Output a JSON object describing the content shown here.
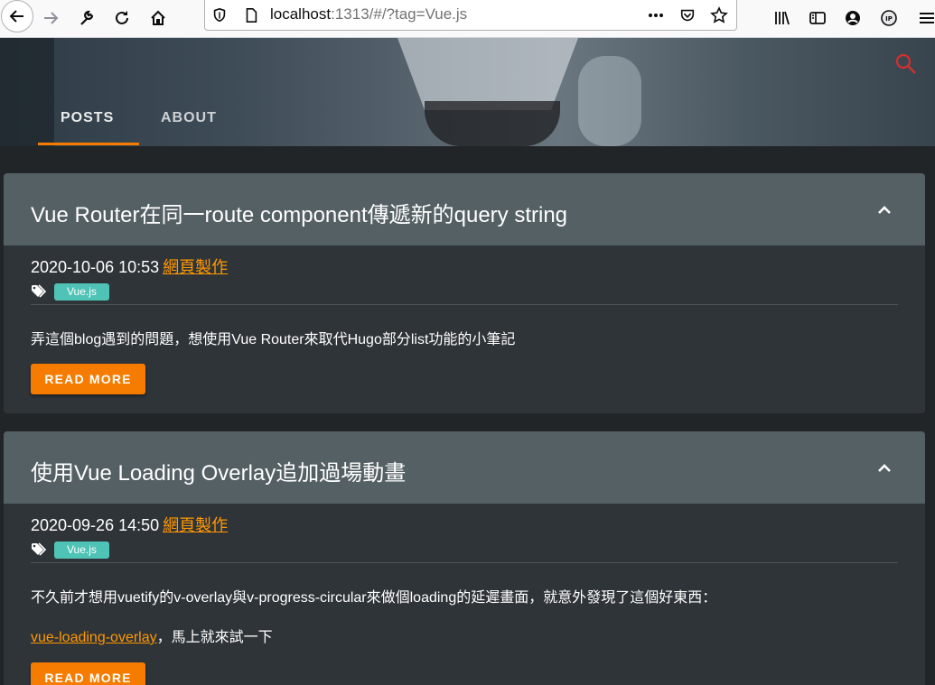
{
  "browser": {
    "url_host": "localhost",
    "url_rest": ":1313/#/?tag=Vue.js",
    "icons": [
      "back-icon",
      "forward-icon",
      "wrench-icon",
      "reload-icon",
      "home-icon",
      "shield-icon",
      "page-icon",
      "more-icon",
      "pocket-icon",
      "bookmark-star-icon",
      "library-icon",
      "sidebar-icon",
      "account-icon",
      "ip-extension-icon",
      "menu-icon"
    ]
  },
  "nav": {
    "posts": "POSTS",
    "about": "ABOUT",
    "active": "POSTS",
    "accent": "#f57c00"
  },
  "posts": [
    {
      "title": "Vue Router在同一route component傳遞新的query string",
      "date": "2020-10-06 10:53",
      "category": "網頁製作",
      "tag": "Vue.js",
      "summary": "弄這個blog遇到的問題，想使用Vue Router來取代Hugo部分list功能的小筆記",
      "read_more": "READ MORE"
    },
    {
      "title": "使用Vue Loading Overlay追加過場動畫",
      "date": "2020-09-26 14:50",
      "category": "網頁製作",
      "tag": "Vue.js",
      "summary": "不久前才想用vuetify的v-overlay與v-progress-circular來做個loading的延遲畫面，就意外發現了這個好東西：",
      "link_text": "vue-loading-overlay",
      "link_suffix": "，馬上就來試一下",
      "read_more": "READ MORE"
    }
  ],
  "colors": {
    "card_header": "#556065",
    "card_body": "#2f3439",
    "tag_chip": "#4fc3b6",
    "link": "#ff9800"
  }
}
